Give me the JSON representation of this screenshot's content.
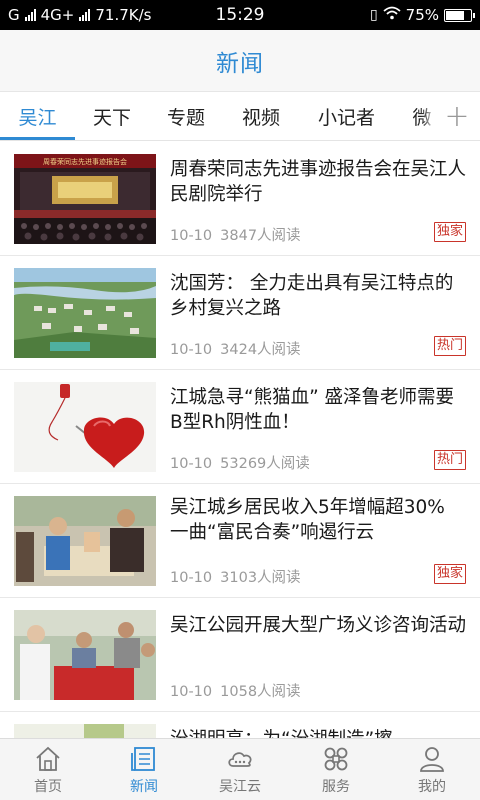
{
  "status_bar": {
    "carrier_left": "G",
    "network": "4G+",
    "speed": "71.7K/s",
    "time": "15:29",
    "battery": "75%",
    "battery_level": 0.75
  },
  "header": {
    "title": "新闻"
  },
  "tabs": [
    {
      "label": "吴江",
      "active": true
    },
    {
      "label": "天下",
      "active": false
    },
    {
      "label": "专题",
      "active": false
    },
    {
      "label": "视频",
      "active": false
    },
    {
      "label": "小记者",
      "active": false
    },
    {
      "label": "微",
      "active": false
    }
  ],
  "tabs_more_icon": "plus-icon",
  "news": [
    {
      "title": "周春荣同志先进事迹报告会在吴江人民剧院举行",
      "date": "10-10",
      "reads": "3847人阅读",
      "badge": "独家",
      "thumb_banner": "周春荣同志先进事迹报告会"
    },
    {
      "title": "沈国芳： 全力走出具有吴江特点的乡村复兴之路",
      "date": "10-10",
      "reads": "3424人阅读",
      "badge": "热门"
    },
    {
      "title": "江城急寻“熊猫血” 盛泽鲁老师需要B型Rh阴性血！",
      "date": "10-10",
      "reads": "53269人阅读",
      "badge": "热门"
    },
    {
      "title": "吴江城乡居民收入5年增幅超30% 一曲“富民合奏”响遏行云",
      "date": "10-10",
      "reads": "3103人阅读",
      "badge": "独家"
    },
    {
      "title": "吴江公园开展大型广场义诊咨询活动",
      "date": "10-10",
      "reads": "1058人阅读",
      "badge": ""
    },
    {
      "title": "汾湖明亮：为“汾湖制造”擦",
      "date": "",
      "reads": "",
      "badge": ""
    }
  ],
  "bottom_nav": [
    {
      "label": "首页",
      "icon": "home-icon",
      "active": false
    },
    {
      "label": "新闻",
      "icon": "news-icon",
      "active": true
    },
    {
      "label": "吴江云",
      "icon": "cloud-icon",
      "active": false
    },
    {
      "label": "服务",
      "icon": "services-icon",
      "active": false
    },
    {
      "label": "我的",
      "icon": "profile-icon",
      "active": false
    }
  ],
  "colors": {
    "accent": "#2f8ad3",
    "badge": "#c9342a"
  }
}
